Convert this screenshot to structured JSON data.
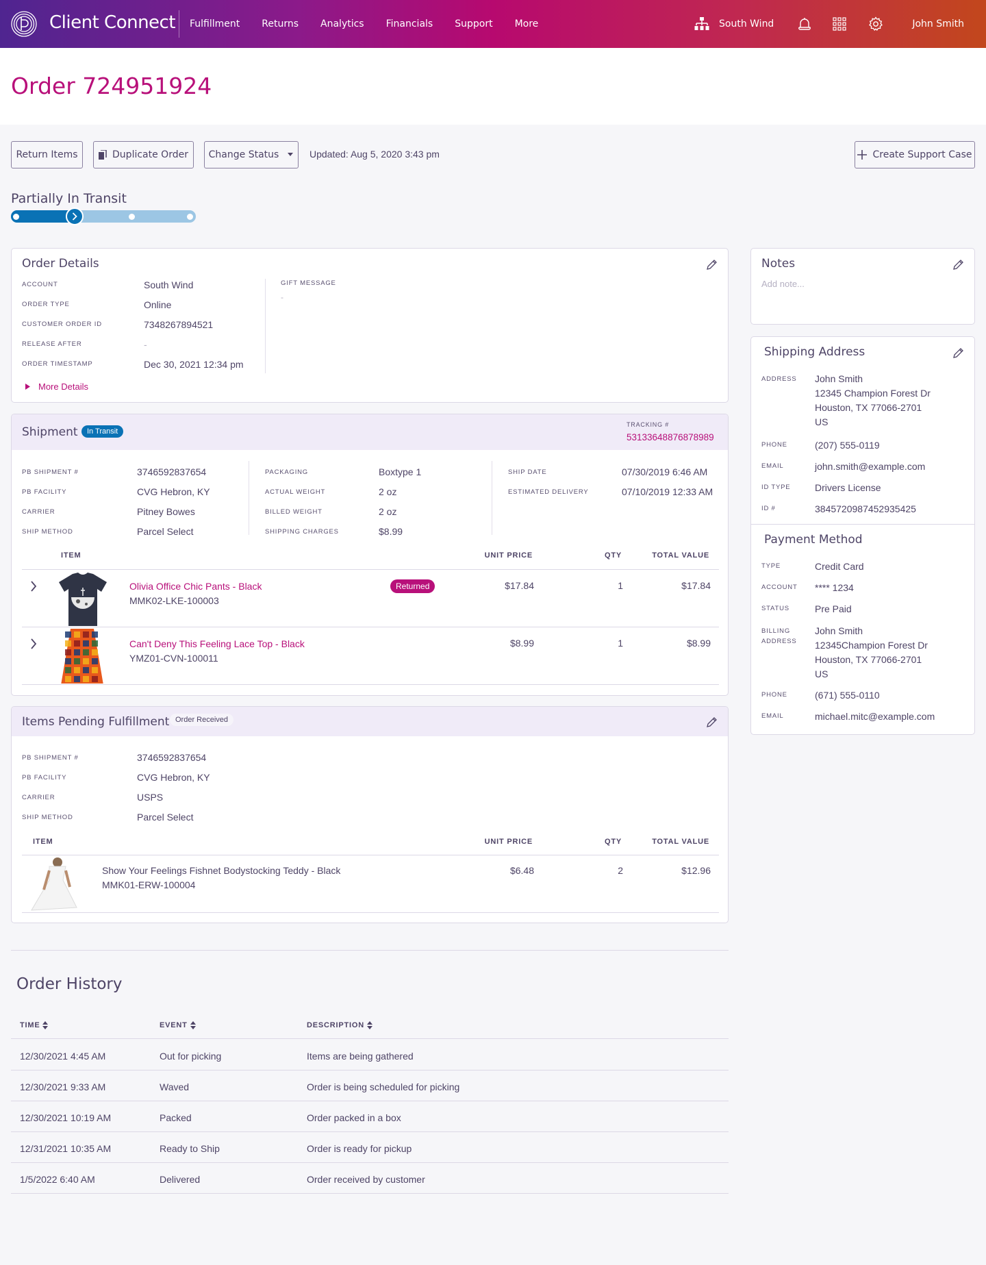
{
  "app": {
    "brand": "Client Connect",
    "nav": [
      "Fulfillment",
      "Returns",
      "Analytics",
      "Financials",
      "Support",
      "More"
    ],
    "account": "South Wind",
    "user": "John Smith"
  },
  "page": {
    "title": "Order 724951924",
    "actions": {
      "return_items": "Return Items",
      "duplicate_order": "Duplicate Order",
      "change_status": "Change Status",
      "create_support_case": "Create Support Case"
    },
    "updated": "Updated: Aug 5, 2020  3:43 pm",
    "status": {
      "label": "Partially In Transit",
      "current_step": 2,
      "total_steps": 4
    }
  },
  "order_details": {
    "title": "Order Details",
    "fields": [
      {
        "label": "ACCOUNT",
        "value": "South Wind"
      },
      {
        "label": "ORDER TYPE",
        "value": "Online"
      },
      {
        "label": "CUSTOMER ORDER ID",
        "value": "7348267894521"
      },
      {
        "label": "RELEASE AFTER",
        "value": "-"
      },
      {
        "label": "ORDER TIMESTAMP",
        "value": "Dec 30, 2021 12:34 pm"
      }
    ],
    "gift_message_label": "GIFT MESSAGE",
    "gift_message_value": "-",
    "more_details": "More Details"
  },
  "shipment": {
    "title": "Shipment",
    "badge": "In Transit",
    "tracking_label": "TRACKING #",
    "tracking_number": "53133648876878989",
    "col1": [
      {
        "label": "PB SHIPMENT #",
        "value": "3746592837654"
      },
      {
        "label": "PB FACILITY",
        "value": "CVG Hebron, KY"
      },
      {
        "label": "CARRIER",
        "value": "Pitney Bowes"
      },
      {
        "label": "SHIP METHOD",
        "value": "Parcel Select"
      }
    ],
    "col2": [
      {
        "label": "PACKAGING",
        "value": "Boxtype 1"
      },
      {
        "label": "ACTUAL WEIGHT",
        "value": "2 oz"
      },
      {
        "label": "BILLED WEIGHT",
        "value": "2 oz"
      },
      {
        "label": "SHIPPING CHARGES",
        "value": "$8.99"
      }
    ],
    "col3": [
      {
        "label": "SHIP DATE",
        "value": "07/30/2019 6:46 AM"
      },
      {
        "label": "ESTIMATED DELIVERY",
        "value": "07/10/2019 12:33 AM"
      }
    ],
    "table_headers": {
      "item": "ITEM",
      "unit_price": "UNIT PRICE",
      "qty": "QTY",
      "total": "TOTAL VALUE"
    },
    "items": [
      {
        "name": "Olivia Office Chic Pants - Black",
        "sku": "MMK02-LKE-100003",
        "badge": "Returned",
        "unit_price": "$17.84",
        "qty": "1",
        "total": "$17.84"
      },
      {
        "name": "Can't Deny This Feeling Lace Top - Black",
        "sku": "YMZ01-CVN-100011",
        "badge": "",
        "unit_price": "$8.99",
        "qty": "1",
        "total": "$8.99"
      }
    ]
  },
  "pending": {
    "title": "Items Pending Fulfillment",
    "badge": "Order Received",
    "fields": [
      {
        "label": "PB SHIPMENT #",
        "value": "3746592837654"
      },
      {
        "label": "PB FACILITY",
        "value": "CVG Hebron, KY"
      },
      {
        "label": "CARRIER",
        "value": "USPS"
      },
      {
        "label": "SHIP METHOD",
        "value": "Parcel Select"
      }
    ],
    "table_headers": {
      "item": "ITEM",
      "unit_price": "UNIT PRICE",
      "qty": "QTY",
      "total": "TOTAL VALUE"
    },
    "items": [
      {
        "name": "Show Your Feelings Fishnet Bodystocking Teddy - Black",
        "sku": "MMK01-ERW-100004",
        "unit_price": "$6.48",
        "qty": "2",
        "total": "$12.96"
      }
    ]
  },
  "notes": {
    "title": "Notes",
    "placeholder": "Add note..."
  },
  "shipping_address": {
    "title": "Shipping Address",
    "address_label": "ADDRESS",
    "address_lines": [
      "John Smith",
      "12345 Champion Forest Dr",
      "Houston, TX 77066-2701",
      "US"
    ],
    "fields": [
      {
        "label": "PHONE",
        "value": "(207) 555-0119"
      },
      {
        "label": "EMAIL",
        "value": "john.smith@example.com"
      },
      {
        "label": "ID TYPE",
        "value": "Drivers License"
      },
      {
        "label": "ID #",
        "value": "3845720987452935425"
      }
    ]
  },
  "payment": {
    "title": "Payment Method",
    "fields": [
      {
        "label": "TYPE",
        "value": "Credit Card"
      },
      {
        "label": "ACCOUNT",
        "value": "**** 1234"
      },
      {
        "label": "STATUS",
        "value": "Pre Paid"
      }
    ],
    "billing_label_1": "BILLING",
    "billing_label_2": "ADDRESS",
    "billing_lines": [
      "John Smith",
      "12345Champion Forest Dr",
      "Houston, TX 77066-2701",
      "US"
    ],
    "fields2": [
      {
        "label": "PHONE",
        "value": "(671) 555-0110"
      },
      {
        "label": "EMAIL",
        "value": "michael.mitc@example.com"
      }
    ]
  },
  "history": {
    "title": "Order History",
    "headers": [
      "TIME",
      "EVENT",
      "DESCRIPTION"
    ],
    "rows": [
      {
        "time": "12/30/2021 4:45 AM",
        "event": "Out for picking",
        "description": "Items are being gathered"
      },
      {
        "time": "12/30/2021 9:33 AM",
        "event": "Waved",
        "description": "Order is being scheduled for picking"
      },
      {
        "time": "12/30/2021 10:19 AM",
        "event": "Packed",
        "description": "Order packed in a box"
      },
      {
        "time": "12/31/2021 10:35 AM",
        "event": "Ready to Ship",
        "description": "Order is ready for pickup"
      },
      {
        "time": "1/5/2022 6:40 AM",
        "event": "Delivered",
        "description": "Order received by customer"
      }
    ]
  },
  "colors": {
    "accent": "#b8107a",
    "primary_text": "#4e4466",
    "in_transit": "#0a72b5",
    "progress_track": "#9cc6e4"
  }
}
